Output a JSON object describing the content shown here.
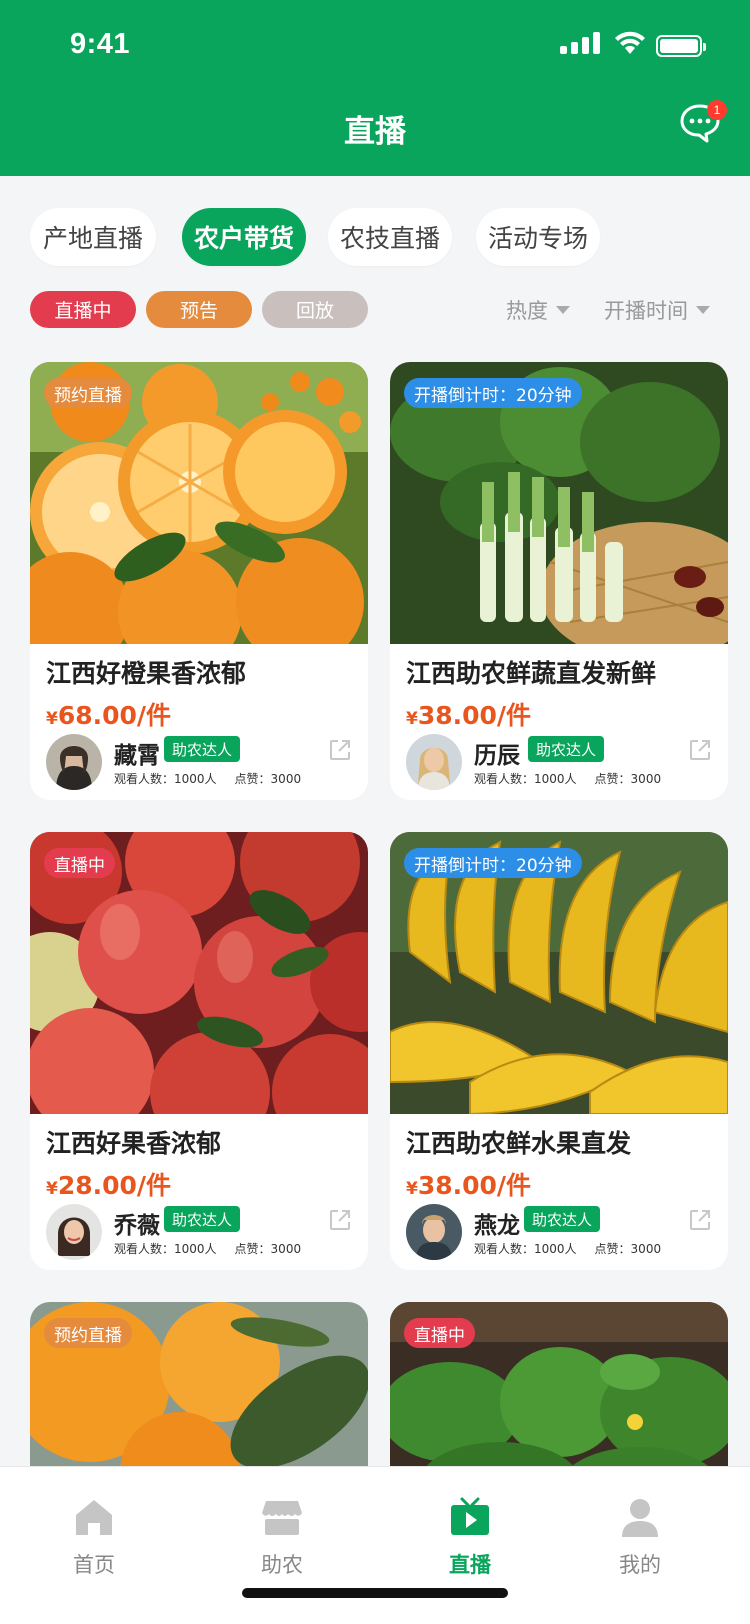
{
  "status_bar": {
    "time": "9:41"
  },
  "header": {
    "title": "直播",
    "message_badge": "1"
  },
  "category_tabs": [
    {
      "label": "产地直播",
      "active": false
    },
    {
      "label": "农户带货",
      "active": true
    },
    {
      "label": "农技直播",
      "active": false
    },
    {
      "label": "活动专场",
      "active": false
    }
  ],
  "status_filters": [
    {
      "label": "直播中",
      "color": "#e33c4f"
    },
    {
      "label": "预告",
      "color": "#e48b3e"
    },
    {
      "label": "回放",
      "color": "#c9c0be"
    }
  ],
  "sort_options": [
    {
      "label": "热度"
    },
    {
      "label": "开播时间"
    }
  ],
  "cards": [
    {
      "tag": "预约直播",
      "tag_color": "#e48b3e",
      "title": "江西好橙果香浓郁",
      "price_symbol": "¥",
      "price": "68.00/件",
      "author": "藏霄",
      "badge": "助农达人",
      "viewers": "观看人数：1000人",
      "likes": "点赞：3000",
      "image": "oranges"
    },
    {
      "tag": "开播倒计时：20分钟",
      "tag_color": "#2d8ee8",
      "title": "江西助农鲜蔬直发新鲜",
      "price_symbol": "¥",
      "price": "38.00/件",
      "author": "历辰",
      "badge": "助农达人",
      "viewers": "观看人数：1000人",
      "likes": "点赞：3000",
      "image": "vegetables"
    },
    {
      "tag": "直播中",
      "tag_color": "#e33c4f",
      "title": "江西好果香浓郁",
      "price_symbol": "¥",
      "price": "28.00/件",
      "author": "乔薇",
      "badge": "助农达人",
      "viewers": "观看人数：1000人",
      "likes": "点赞：3000",
      "image": "apples"
    },
    {
      "tag": "开播倒计时：20分钟",
      "tag_color": "#2d8ee8",
      "title": "江西助农鲜水果直发",
      "price_symbol": "¥",
      "price": "38.00/件",
      "author": "燕龙",
      "badge": "助农达人",
      "viewers": "观看人数：1000人",
      "likes": "点赞：3000",
      "image": "bananas"
    },
    {
      "tag": "预约直播",
      "tag_color": "#e48b3e",
      "image": "oranges-tree"
    },
    {
      "tag": "直播中",
      "tag_color": "#e33c4f",
      "image": "greens"
    }
  ],
  "bottom_nav": [
    {
      "label": "首页",
      "icon": "home-icon",
      "active": false
    },
    {
      "label": "助农",
      "icon": "store-icon",
      "active": false
    },
    {
      "label": "直播",
      "icon": "tv-play-icon",
      "active": true
    },
    {
      "label": "我的",
      "icon": "user-icon",
      "active": false
    }
  ]
}
